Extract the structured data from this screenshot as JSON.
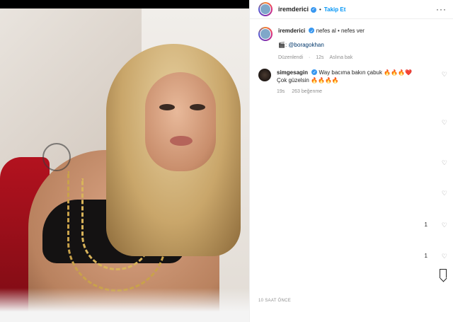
{
  "post": {
    "username": "iremderici",
    "follow_label": "Takip Et",
    "separator": "•",
    "more_label": "···",
    "caption": "nefes al • nefes ver",
    "credit_prefix": "🎬:",
    "credit_mention": "@boragokhan",
    "edited_label": "Düzenlendi",
    "edited_time": "12s",
    "see_original": "Aslına bak",
    "time_ago": "10 SAAT ÖNCE"
  },
  "comments": [
    {
      "username": "simgesagin",
      "text_line1": "Way bacıma bakın çabuk 🔥🔥🔥❤️",
      "text_line2": "Çok güzelsin 🔥🔥🔥🔥",
      "time": "19s",
      "likes": "263 beğenme"
    }
  ],
  "side_marks": [
    "1",
    "1"
  ],
  "colors": {
    "accent": "#0095f6",
    "verified": "#3897f0",
    "muted": "#8e8e8e"
  }
}
